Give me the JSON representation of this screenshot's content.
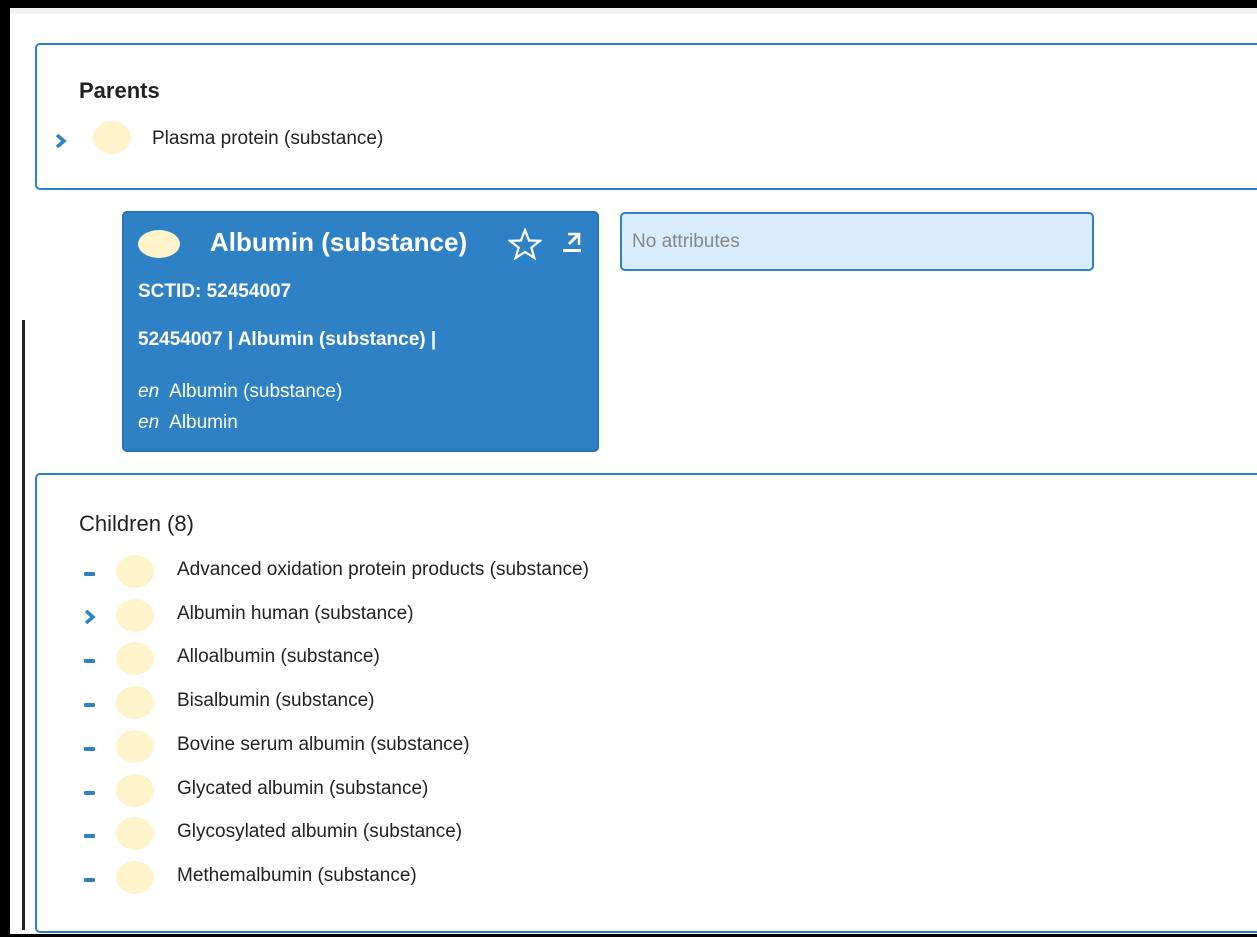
{
  "parents": {
    "title": "Parents",
    "items": [
      {
        "label": "Plasma protein (substance)",
        "expander": "chevron-right"
      }
    ]
  },
  "concept": {
    "title": "Albumin (substance)",
    "sctid_text": "SCTID: 52454007",
    "fsn_text": "52454007 | Albumin (substance) |",
    "descriptions": [
      {
        "lang": "en",
        "term": "Albumin (substance)"
      },
      {
        "lang": "en",
        "term": "Albumin"
      }
    ],
    "icons": [
      "star-icon",
      "export-icon"
    ]
  },
  "attributes": {
    "text": "No attributes"
  },
  "children": {
    "title": "Children (8)",
    "items": [
      {
        "label": "Advanced oxidation protein products (substance)",
        "expander": "dash"
      },
      {
        "label": "Albumin human (substance)",
        "expander": "chevron-right"
      },
      {
        "label": "Alloalbumin (substance)",
        "expander": "dash"
      },
      {
        "label": "Bisalbumin (substance)",
        "expander": "dash"
      },
      {
        "label": "Bovine serum albumin (substance)",
        "expander": "dash"
      },
      {
        "label": "Glycated albumin (substance)",
        "expander": "dash"
      },
      {
        "label": "Glycosylated albumin (substance)",
        "expander": "dash"
      },
      {
        "label": "Methemalbumin (substance)",
        "expander": "dash"
      }
    ]
  },
  "colors": {
    "primary": "#2f81c6",
    "bubble": "#fdf4cc",
    "attributes_bg": "#d9ecfb"
  }
}
